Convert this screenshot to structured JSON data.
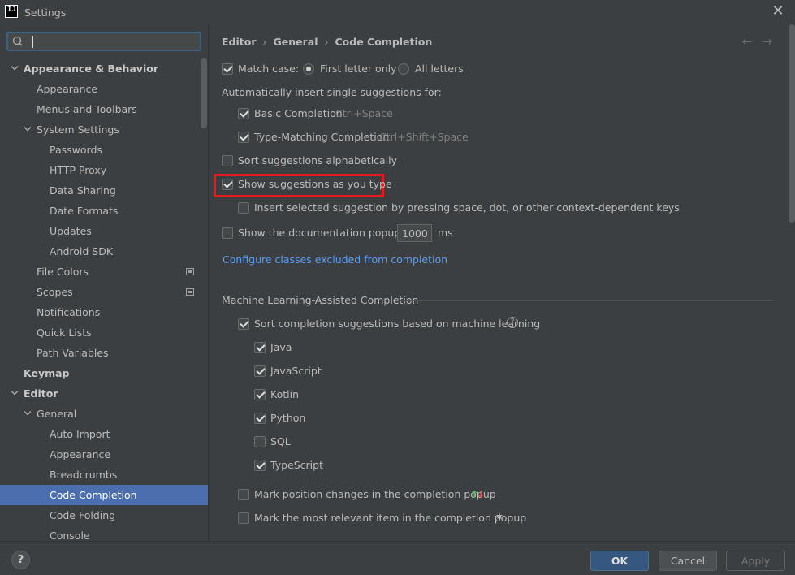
{
  "window": {
    "title": "Settings",
    "logo_text": "IJ"
  },
  "sidebar": {
    "search_value": "",
    "items": [
      {
        "label": "Appearance & Behavior"
      },
      {
        "label": "Appearance"
      },
      {
        "label": "Menus and Toolbars"
      },
      {
        "label": "System Settings"
      },
      {
        "label": "Passwords"
      },
      {
        "label": "HTTP Proxy"
      },
      {
        "label": "Data Sharing"
      },
      {
        "label": "Date Formats"
      },
      {
        "label": "Updates"
      },
      {
        "label": "Android SDK"
      },
      {
        "label": "File Colors"
      },
      {
        "label": "Scopes"
      },
      {
        "label": "Notifications"
      },
      {
        "label": "Quick Lists"
      },
      {
        "label": "Path Variables"
      },
      {
        "label": "Keymap"
      },
      {
        "label": "Editor"
      },
      {
        "label": "General"
      },
      {
        "label": "Auto Import"
      },
      {
        "label": "Appearance"
      },
      {
        "label": "Breadcrumbs"
      },
      {
        "label": "Code Completion"
      },
      {
        "label": "Code Folding"
      },
      {
        "label": "Console"
      }
    ]
  },
  "breadcrumb": [
    "Editor",
    "General",
    "Code Completion"
  ],
  "nav": {
    "back": "←",
    "forward": "→"
  },
  "options": {
    "match_case": "Match case:",
    "first_letter_only": "First letter only",
    "all_letters": "All letters",
    "auto_insert_header": "Automatically insert single suggestions for:",
    "basic_completion": "Basic Completion",
    "basic_shortcut": "Ctrl+Space",
    "type_matching": "Type-Matching Completion",
    "type_matching_shortcut": "Ctrl+Shift+Space",
    "sort_alpha": "Sort suggestions alphabetically",
    "show_as_type": "Show suggestions as you type",
    "insert_selected": "Insert selected suggestion by pressing space, dot, or other context-dependent keys",
    "show_doc_popup": "Show the documentation popup in",
    "doc_popup_ms": "1000",
    "ms": "ms",
    "configure_link": "Configure classes excluded from completion"
  },
  "ml": {
    "section_title": "Machine Learning-Assisted Completion",
    "sort_ml": "Sort completion suggestions based on machine learning",
    "help": "?",
    "languages": [
      {
        "label": "Java",
        "checked": true
      },
      {
        "label": "JavaScript",
        "checked": true
      },
      {
        "label": "Kotlin",
        "checked": true
      },
      {
        "label": "Python",
        "checked": true
      },
      {
        "label": "SQL",
        "checked": false
      },
      {
        "label": "TypeScript",
        "checked": true
      }
    ],
    "mark_position": "Mark position changes in the completion popup",
    "mark_relevant": "Mark the most relevant item in the completion popup",
    "arrow_up": "↑",
    "arrow_down": "↓",
    "star": "★"
  },
  "footer": {
    "help": "?",
    "ok": "OK",
    "cancel": "Cancel",
    "apply": "Apply"
  },
  "colors": {
    "accent": "#4b6eaf",
    "highlight": "#e6191f",
    "link": "#589df6",
    "ok_button": "#365880"
  }
}
